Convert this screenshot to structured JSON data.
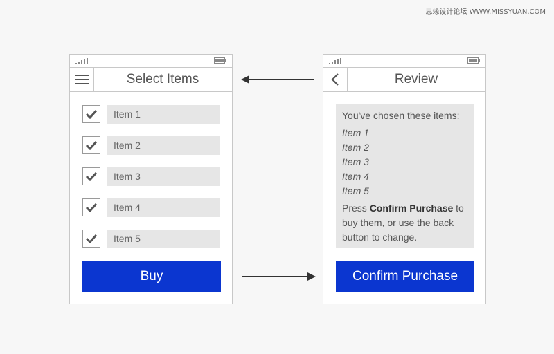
{
  "watermark": "思缘设计论坛 WWW.MISSYUAN.COM",
  "colors": {
    "accent": "#0b36d0",
    "field_bg": "#e6e6e6",
    "border": "#c8c8c8",
    "arrow": "#333333"
  },
  "left_screen": {
    "title": "Select Items",
    "menu_icon": "hamburger-icon",
    "items": [
      {
        "label": "Item 1",
        "checked": true
      },
      {
        "label": "Item 2",
        "checked": true
      },
      {
        "label": "Item 3",
        "checked": true
      },
      {
        "label": "Item 4",
        "checked": true
      },
      {
        "label": "Item 5",
        "checked": true
      }
    ],
    "buy_label": "Buy"
  },
  "right_screen": {
    "title": "Review",
    "back_icon": "chevron-left-icon",
    "intro": "You've chosen these items:",
    "chosen": [
      "Item 1",
      "Item 2",
      "Item 3",
      "Item 4",
      "Item 5"
    ],
    "note_prefix": "Press ",
    "note_bold": "Confirm Purchase",
    "note_suffix": " to buy them, or use the back button to change.",
    "confirm_label": "Confirm Purchase"
  }
}
